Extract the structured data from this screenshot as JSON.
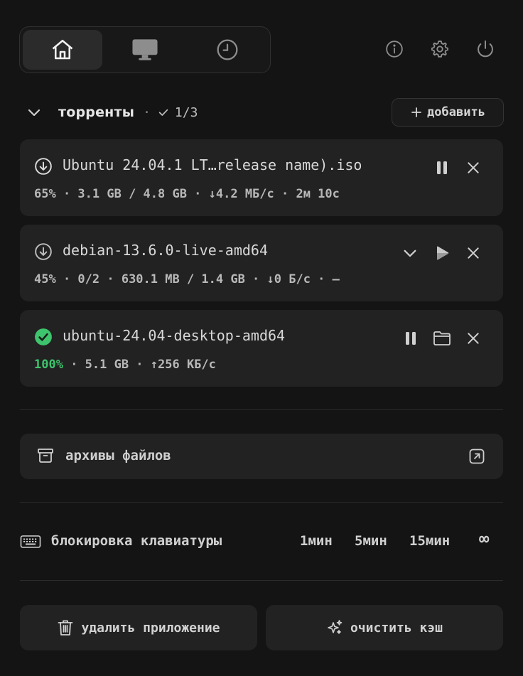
{
  "tabs": [
    {
      "icon": "home-icon",
      "active": true
    },
    {
      "icon": "monitor-icon",
      "active": false
    },
    {
      "icon": "clock-icon",
      "active": false
    }
  ],
  "top_icons": [
    "info-icon",
    "gear-icon",
    "power-icon"
  ],
  "torrents_section": {
    "title": "торренты",
    "separator": "·",
    "count": "1/3",
    "add_label": "добавить"
  },
  "torrents": [
    {
      "name": "Ubuntu 24.04.1 LT…release name).iso",
      "status": "downloading",
      "progress": "65%",
      "meta_rest": " · 3.1 GB / 4.8 GB · ↓4.2 МБ/с · 2м 10с",
      "actions": [
        "pause-icon",
        "close-icon"
      ]
    },
    {
      "name": "debian-13.6.0-live-amd64",
      "status": "paused",
      "progress": "45%",
      "meta_rest": " · 0/2 · 630.1 MB / 1.4 GB · ↓0 Б/с · —",
      "actions": [
        "chevron-down-icon",
        "play-icon",
        "close-icon"
      ]
    },
    {
      "name": "ubuntu-24.04-desktop-amd64",
      "status": "completed",
      "progress": "100%",
      "meta_rest": " · 5.1 GB · ↑256 КБ/с",
      "actions": [
        "pause-icon",
        "folder-icon",
        "close-icon"
      ]
    }
  ],
  "archives": {
    "label": "архивы файлов"
  },
  "keyboard_lock": {
    "label": "блокировка клавиатуры",
    "options": [
      "1мин",
      "5мин",
      "15мин",
      "∞"
    ]
  },
  "bottom": {
    "uninstall_label": "удалить приложение",
    "clear_cache_label": "очистить кэш"
  },
  "colors": {
    "background": "#141414",
    "card": "#222222",
    "success": "#3ec46d"
  }
}
